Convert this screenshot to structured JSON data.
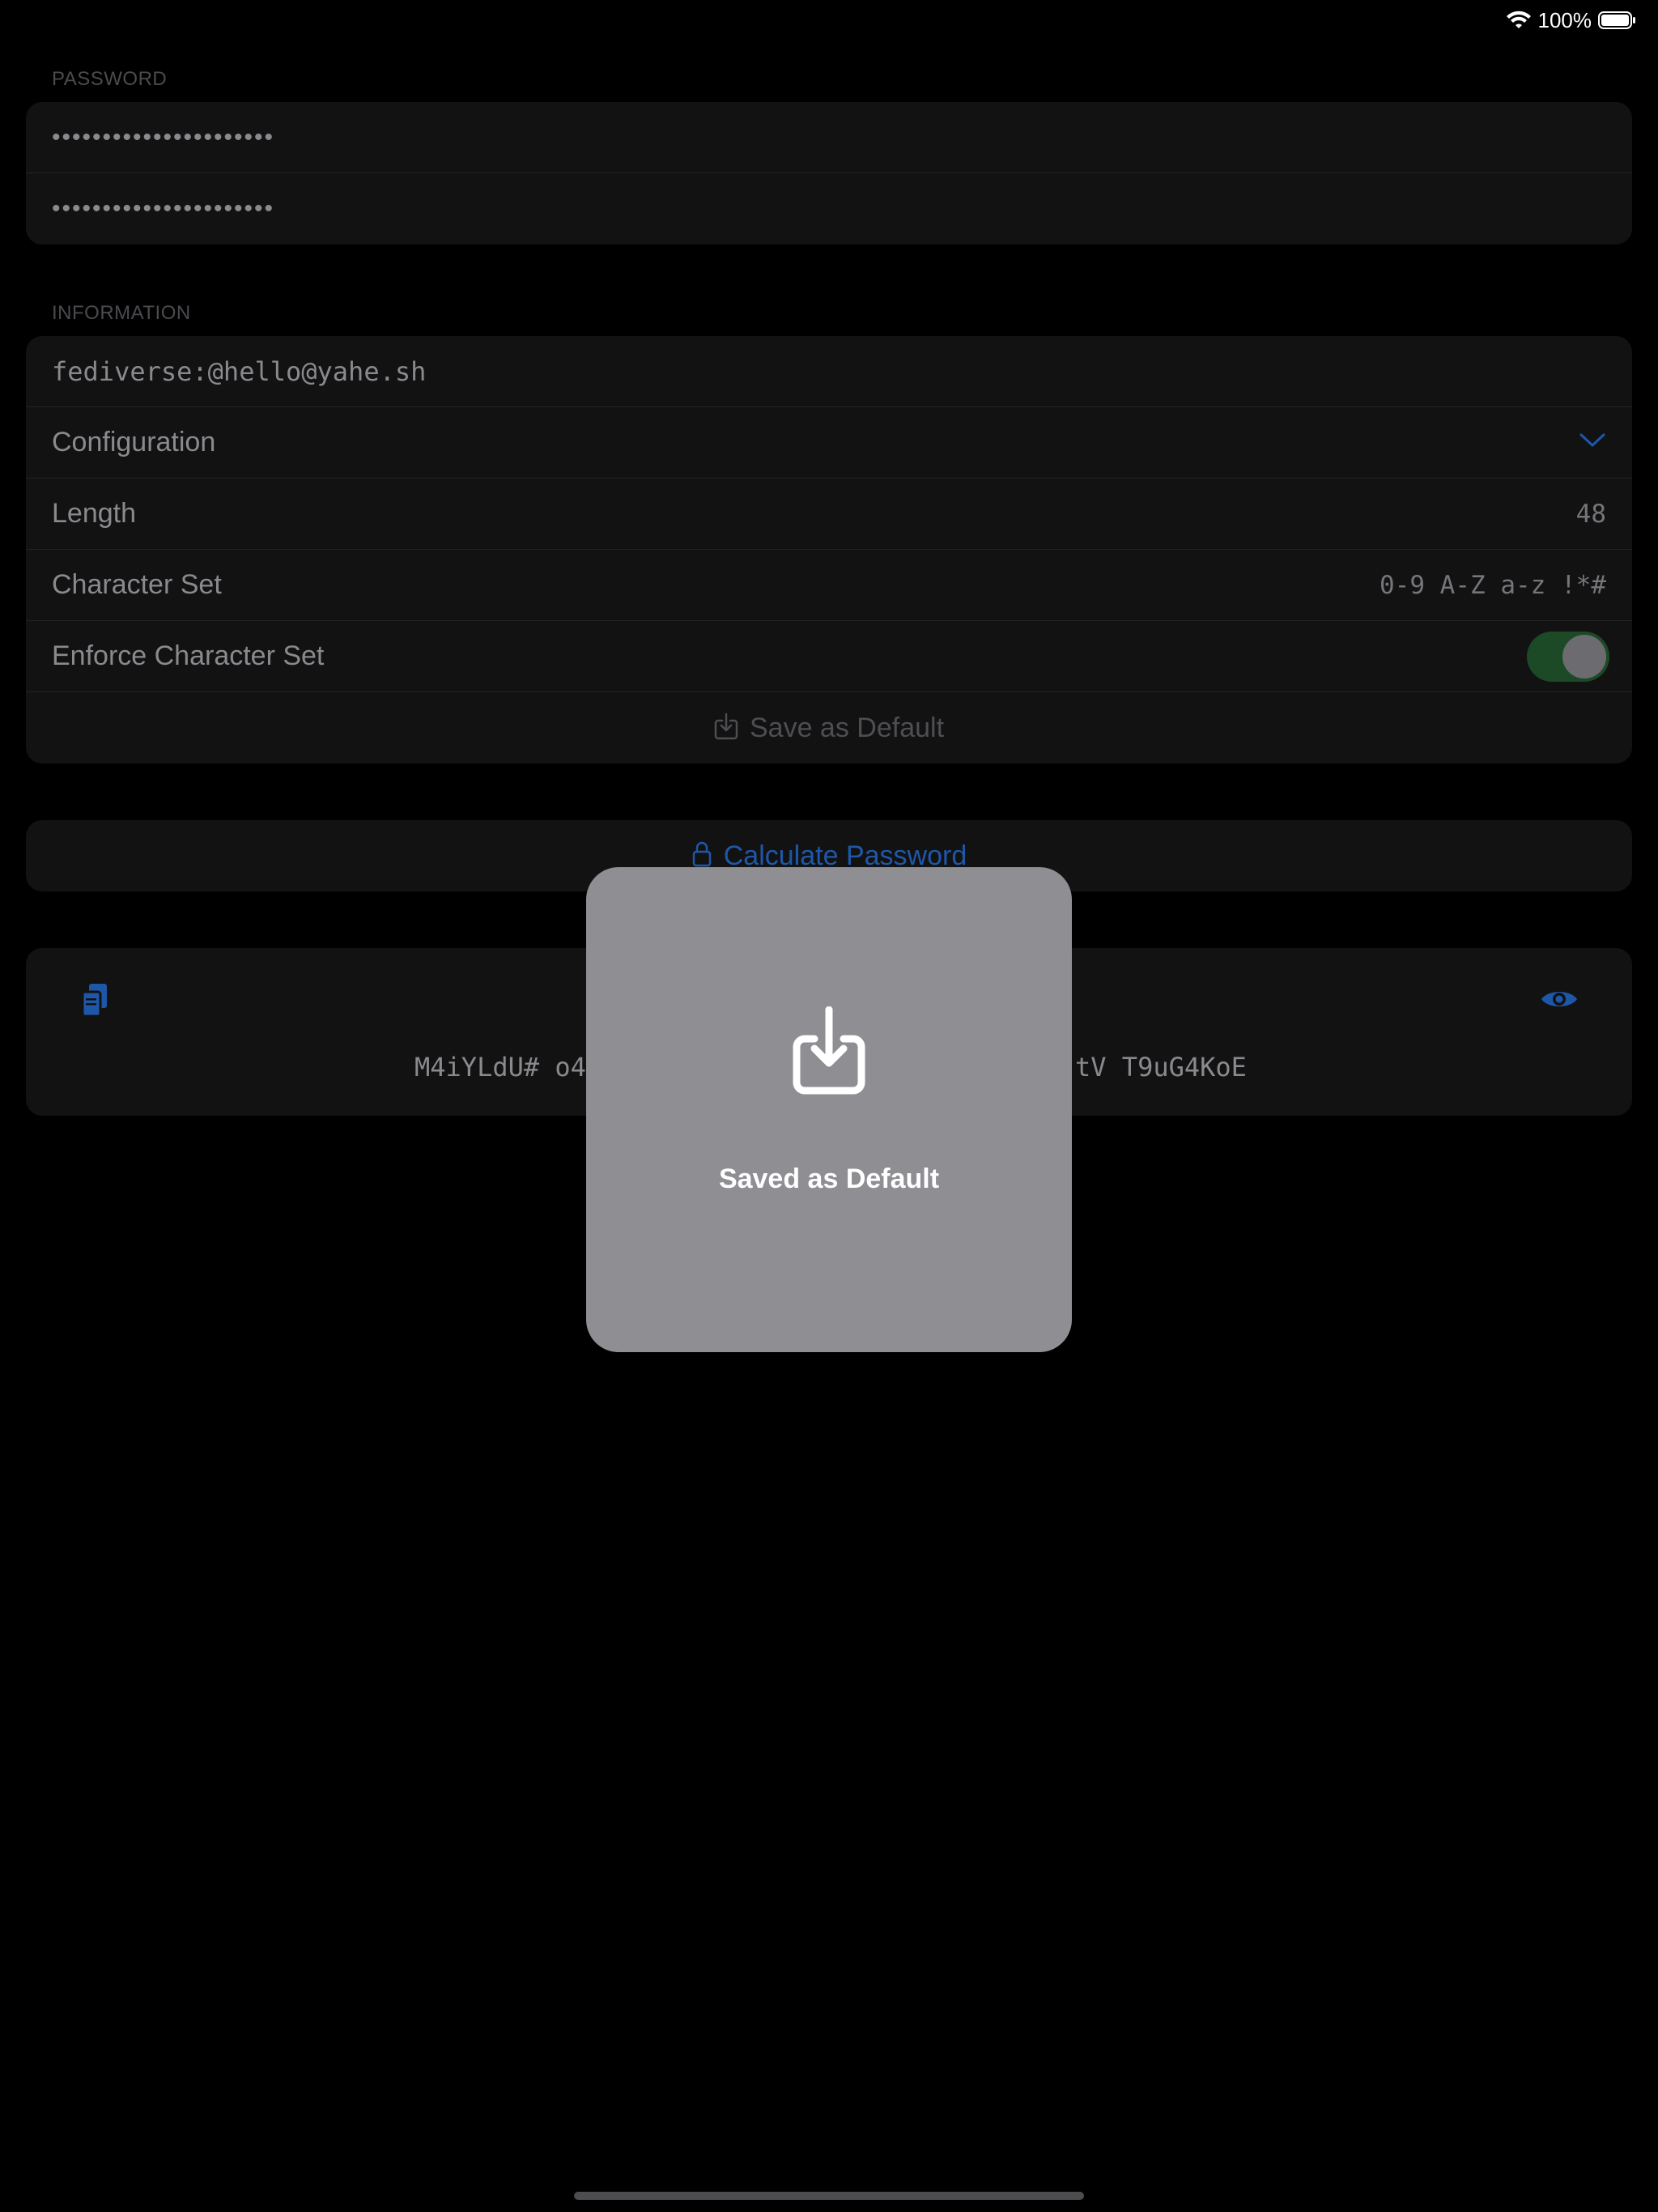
{
  "status_bar": {
    "battery_text": "100%",
    "wifi_icon": "wifi-icon",
    "battery_icon": "battery-icon"
  },
  "password_section": {
    "header": "PASSWORD",
    "field1_masked": "••••••••••••••••••••••",
    "field2_masked": "••••••••••••••••••••••"
  },
  "information_section": {
    "header": "INFORMATION",
    "identifier": "fediverse:@hello@yahe.sh",
    "configuration_label": "Configuration",
    "length_label": "Length",
    "length_value": "48",
    "charset_label": "Character Set",
    "charset_value": "0-9 A-Z a-z !*#",
    "enforce_label": "Enforce Character Set",
    "enforce_on": true,
    "save_default_label": "Save as Default"
  },
  "calculate": {
    "label": "Calculate Password"
  },
  "result": {
    "password_left": "M4iYLdU# o4",
    "password_right": "tV T9uG4KoE"
  },
  "hud": {
    "label": "Saved as Default",
    "icon": "save-download-icon"
  },
  "colors": {
    "accent_blue": "#1e57a8",
    "background": "#000000",
    "card": "#121213",
    "hud": "#8e8e93",
    "toggle_on": "#1d4a26"
  }
}
